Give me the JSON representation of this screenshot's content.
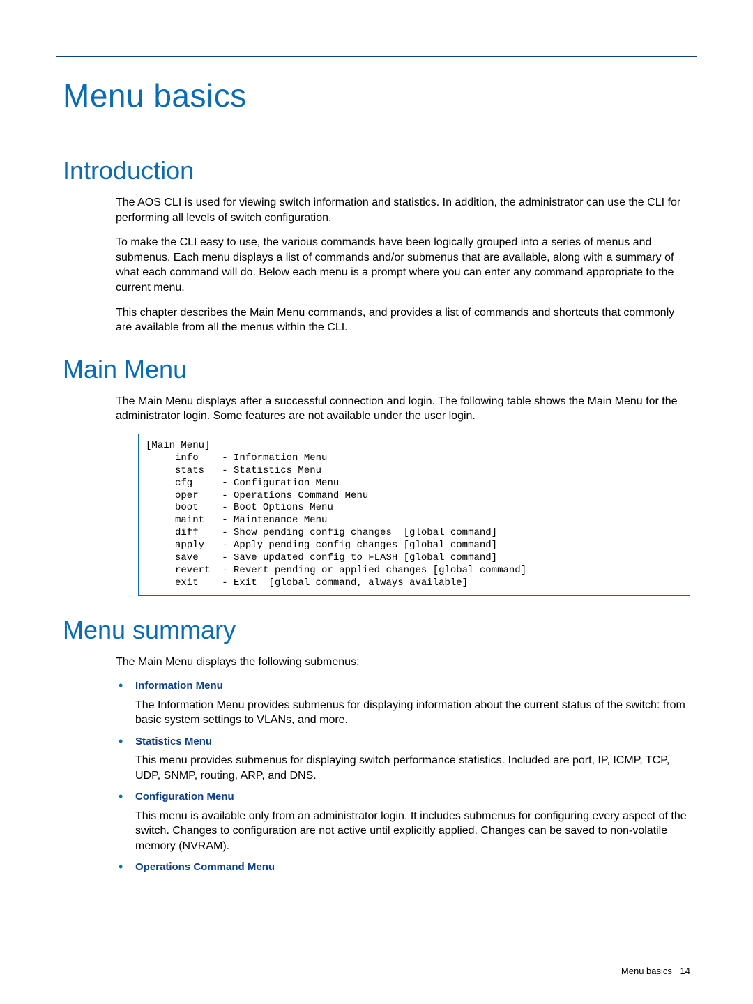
{
  "chapter_title": "Menu basics",
  "sections": {
    "intro": {
      "heading": "Introduction",
      "paras": [
        "The AOS CLI is used for viewing switch information and statistics. In addition, the administrator can use the CLI for performing all levels of switch configuration.",
        "To make the CLI easy to use, the various commands have been logically grouped into a series of menus and submenus. Each menu displays a list of commands and/or submenus that are available, along with a summary of what each command will do. Below each menu is a prompt where you can enter any command appropriate to the current menu.",
        "This chapter describes the Main Menu commands, and provides a list of commands and shortcuts that commonly are available from all the menus within the CLI."
      ]
    },
    "mainmenu": {
      "heading": "Main Menu",
      "intro": "The Main Menu displays after a successful connection and login. The following table shows the Main Menu for the administrator login. Some features are not available under the user login.",
      "code": "[Main Menu]\n     info    - Information Menu\n     stats   - Statistics Menu\n     cfg     - Configuration Menu\n     oper    - Operations Command Menu\n     boot    - Boot Options Menu\n     maint   - Maintenance Menu\n     diff    - Show pending config changes  [global command]\n     apply   - Apply pending config changes [global command]\n     save    - Save updated config to FLASH [global command]\n     revert  - Revert pending or applied changes [global command]\n     exit    - Exit  [global command, always available]"
    },
    "summary": {
      "heading": "Menu summary",
      "intro": "The Main Menu displays the following submenus:",
      "items": [
        {
          "title": "Information Menu",
          "body": "The Information Menu provides submenus for displaying information about the current status of the switch: from basic system settings to VLANs, and more."
        },
        {
          "title": "Statistics Menu",
          "body": "This menu provides submenus for displaying switch performance statistics. Included are port, IP, ICMP, TCP, UDP, SNMP, routing, ARP, and DNS."
        },
        {
          "title": "Configuration Menu",
          "body": "This menu is available only from an administrator login. It includes submenus for configuring every aspect of the switch. Changes to configuration are not active until explicitly applied. Changes can be saved to non-volatile memory (NVRAM)."
        },
        {
          "title": "Operations Command Menu",
          "body": ""
        }
      ]
    }
  },
  "footer": {
    "label": "Menu basics",
    "page": "14"
  }
}
